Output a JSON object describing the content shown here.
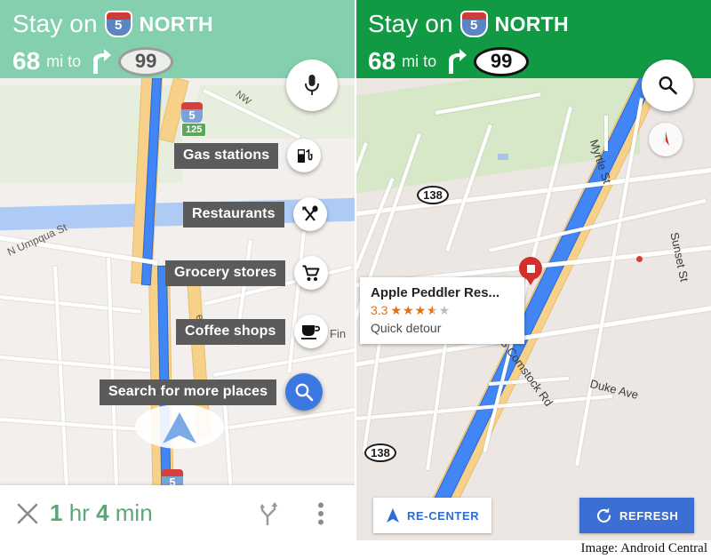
{
  "panels": {
    "left": {
      "header": {
        "bg_color": "#84cfad",
        "stay_on": "Stay on",
        "shield_number": "5",
        "direction": "NORTH",
        "distance": "68",
        "unit": "mi to",
        "turn_icon": "turn-right-icon",
        "next_road": "99"
      },
      "mic_fab": {
        "icon": "microphone-icon",
        "label": "Voice search"
      },
      "chips": [
        {
          "label": "Gas stations",
          "icon": "gas-pump-icon"
        },
        {
          "label": "Restaurants",
          "icon": "fork-spoon-icon"
        },
        {
          "label": "Grocery stores",
          "icon": "shopping-cart-icon"
        },
        {
          "label": "Coffee shops",
          "icon": "coffee-cup-icon"
        },
        {
          "label": "Search for more places",
          "icon": "search-icon"
        }
      ],
      "map": {
        "street_labels": [
          "N Umpqua St",
          "NW",
          "Fin",
          "ello"
        ],
        "shield_i5": "5",
        "exit_badge": "125",
        "shield_i5_bottom": "5",
        "position_marker": "navigation-arrow-icon"
      },
      "bottom_bar": {
        "close_icon": "close-icon",
        "eta_value": "1",
        "eta_unit_hr": "hr",
        "eta_minutes": "4",
        "eta_unit_min": "min",
        "eta_color": "#5aa777",
        "route_icon": "route-fork-icon",
        "overflow_icon": "more-vertical-icon"
      }
    },
    "right": {
      "header": {
        "bg_color": "#129944",
        "stay_on": "Stay on",
        "shield_number": "5",
        "direction": "NORTH",
        "distance": "68",
        "unit": "mi to",
        "turn_icon": "turn-right-icon",
        "next_road": "99"
      },
      "search_fab": {
        "icon": "search-icon"
      },
      "compass": {
        "icon": "compass-needle-icon"
      },
      "map": {
        "street_labels": [
          "Myrtle St",
          "Sunset St",
          "S Comstock Rd",
          "Duke Ave"
        ],
        "route_shields": [
          "138",
          "138"
        ],
        "poi_marker": "map-pin-icon"
      },
      "info_card": {
        "title": "Apple Peddler Res...",
        "rating": "3.3",
        "rating_value": 3.5,
        "rating_max": 5,
        "star_color": "#e8700f",
        "subtitle": "Quick detour"
      },
      "buttons": {
        "recenter_label": "RE-CENTER",
        "recenter_icon": "navigation-arrow-icon",
        "refresh_label": "REFRESH",
        "refresh_icon": "refresh-icon",
        "refresh_bg": "#3b6fd4"
      }
    }
  },
  "footer": {
    "credit": "Image: Android Central"
  }
}
